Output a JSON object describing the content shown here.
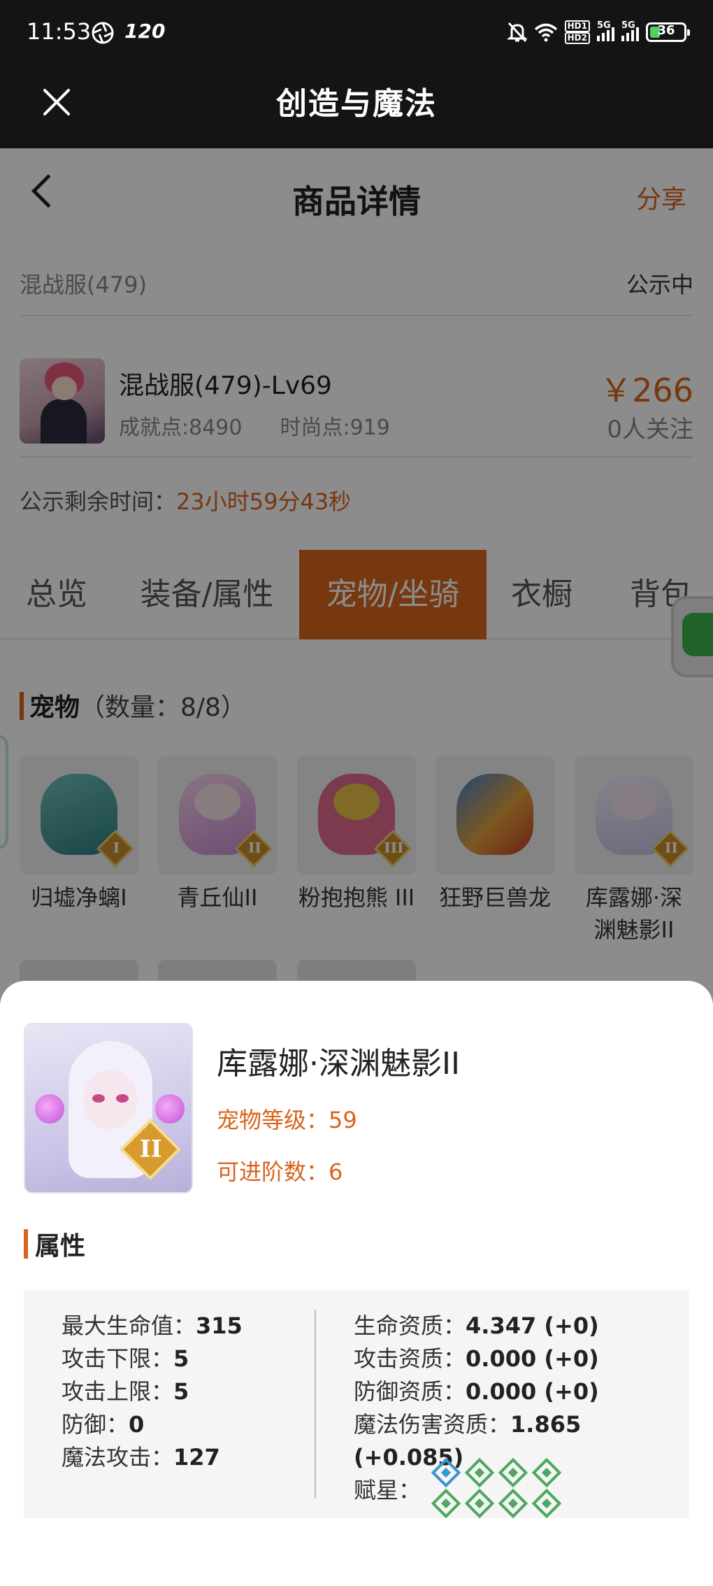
{
  "status_bar": {
    "time": "11:53",
    "refresh_rate": "120",
    "battery": "36",
    "network": "5G"
  },
  "app_bar": {
    "title": "创造与魔法"
  },
  "header": {
    "title": "商品详情",
    "share_label": "分享"
  },
  "server": {
    "name": "混战服(479)",
    "status": "公示中"
  },
  "character": {
    "name": "混战服(479)-Lv69",
    "achievement": "成就点:8490",
    "fashion": "时尚点:919",
    "price": "￥266",
    "followers": "0人关注"
  },
  "remaining": {
    "label": "公示剩余时间：",
    "value": "23小时59分43秒"
  },
  "tabs": [
    {
      "label": "总览",
      "active": false
    },
    {
      "label": "装备/属性",
      "active": false
    },
    {
      "label": "宠物/坐骑",
      "active": true
    },
    {
      "label": "衣橱",
      "active": false
    },
    {
      "label": "背包",
      "active": false
    }
  ],
  "pets_section": {
    "title": "宠物",
    "count": "（数量：8/8）"
  },
  "pets": [
    {
      "name": "归墟净螭I",
      "rank": "I"
    },
    {
      "name": "青丘仙II",
      "rank": "II"
    },
    {
      "name": "粉抱抱熊 III",
      "rank": "III"
    },
    {
      "name": "狂野巨兽龙",
      "rank": ""
    },
    {
      "name": "库露娜·深渊魅影II",
      "rank": "II"
    }
  ],
  "detail": {
    "name": "库露娜·深渊魅影II",
    "rank": "II",
    "level": "宠物等级：59",
    "advance": "可进阶数：6",
    "attr_title": "属性",
    "left": [
      {
        "label": "最大生命值：",
        "value": "315"
      },
      {
        "label": "攻击下限：",
        "value": "5"
      },
      {
        "label": "攻击上限：",
        "value": "5"
      },
      {
        "label": "防御：",
        "value": "0"
      },
      {
        "label": "魔法攻击：",
        "value": "127"
      }
    ],
    "right": [
      {
        "label": "生命资质：",
        "value": "4.347 (+0)"
      },
      {
        "label": "攻击资质：",
        "value": "0.000 (+0)"
      },
      {
        "label": "防御资质：",
        "value": "0.000 (+0)"
      },
      {
        "label": "魔法伤害资质：",
        "value": "1.865 (+0.085)"
      }
    ],
    "stars_label": "赋星：",
    "stars": [
      "blue",
      "green",
      "green",
      "green",
      "green",
      "green",
      "green",
      "green"
    ]
  }
}
